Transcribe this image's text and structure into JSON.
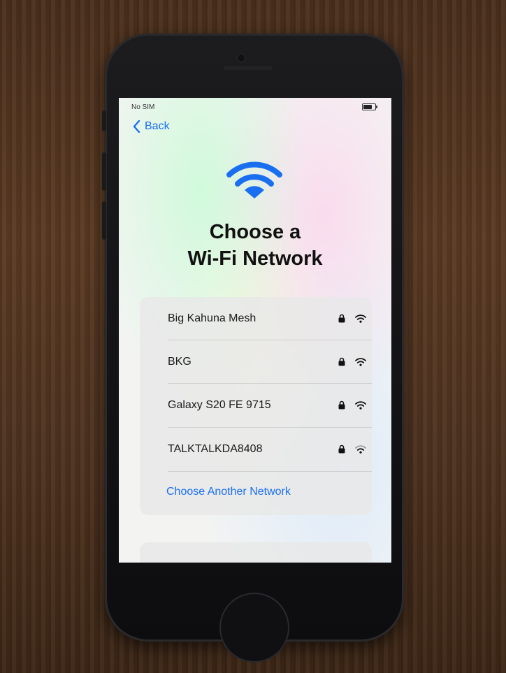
{
  "status_bar": {
    "carrier": "No SIM",
    "battery_icon": "battery-icon"
  },
  "nav": {
    "back_label": "Back"
  },
  "header": {
    "icon": "wifi-icon",
    "title_line1": "Choose a",
    "title_line2": "Wi-Fi Network"
  },
  "networks": [
    {
      "name": "Big Kahuna Mesh",
      "secured": true,
      "signal": "full"
    },
    {
      "name": "BKG",
      "secured": true,
      "signal": "full"
    },
    {
      "name": "Galaxy S20 FE 9715",
      "secured": true,
      "signal": "full"
    },
    {
      "name": "TALKTALKDA8408",
      "secured": true,
      "signal": "weak"
    }
  ],
  "other_network_label": "Choose Another Network",
  "colors": {
    "accent": "#1a6ff1",
    "text": "#111111"
  }
}
